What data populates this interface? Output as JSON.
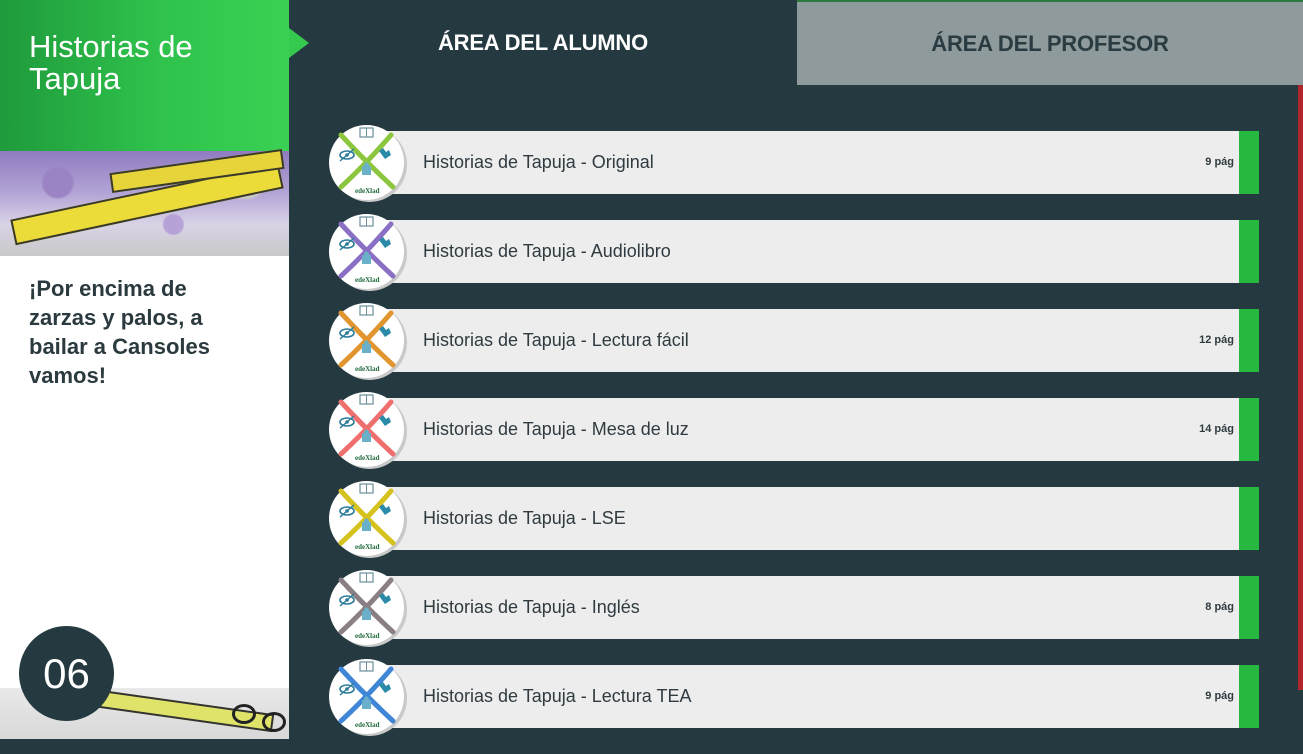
{
  "book": {
    "title": "Historias de Tapuja",
    "subtitle": "¡Por encima de zarzas y palos, a bailar a Cansoles vamos!",
    "number": "06"
  },
  "tabs": {
    "student": "ÁREA DEL ALUMNO",
    "teacher": "ÁREA DEL PROFESOR"
  },
  "colors": {
    "dark": "#243a40",
    "green": "#27b83f",
    "tab_inactive": "#8e9a9b"
  },
  "items": [
    {
      "label": "Historias de Tapuja - Original",
      "pages": "9 pág",
      "logo_color": "#8cc63f",
      "logo_text": "edeXlad"
    },
    {
      "label": "Historias de Tapuja - Audiolibro",
      "pages": "",
      "logo_color": "#8a6fc4",
      "logo_text": "edeXlad"
    },
    {
      "label": "Historias de Tapuja - Lectura fácil",
      "pages": "12 pág",
      "logo_color": "#e0952f",
      "logo_text": "edeXlad"
    },
    {
      "label": "Historias de Tapuja - Mesa de luz",
      "pages": "14 pág",
      "logo_color": "#ef6f6f",
      "logo_text": "edeXlad"
    },
    {
      "label": "Historias de Tapuja - LSE",
      "pages": "",
      "logo_color": "#d6c21f",
      "logo_text": "edeXlad"
    },
    {
      "label": "Historias de Tapuja - Inglés",
      "pages": "8 pág",
      "logo_color": "#8a7f84",
      "logo_text": "edeXlad"
    },
    {
      "label": "Historias de Tapuja - Lectura TEA",
      "pages": "9 pág",
      "logo_color": "#3f86d6",
      "logo_text": "edeXlad"
    }
  ]
}
